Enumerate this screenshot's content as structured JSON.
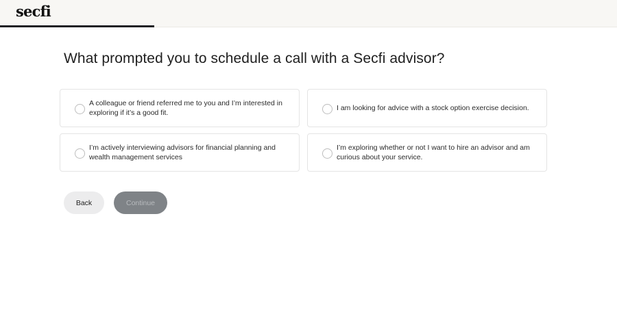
{
  "header": {
    "logo_text": "secfi"
  },
  "progress": {
    "fraction": 0.25
  },
  "question": {
    "title": "What prompted you to schedule a call with a Secfi advisor?"
  },
  "options": [
    {
      "label": "A colleague or friend referred me to you and I’m interested in exploring if it’s a good fit.",
      "selected": false
    },
    {
      "label": "I am looking for advice with a stock option exercise decision.",
      "selected": false
    },
    {
      "label": "I’m actively interviewing advisors for financial planning and wealth management services",
      "selected": false
    },
    {
      "label": "I’m exploring whether or not I want to hire an advisor and am curious about your service.",
      "selected": false
    }
  ],
  "buttons": {
    "back_label": "Back",
    "continue_label": "Continue",
    "continue_disabled": true
  },
  "colors": {
    "accent": "#1f1f24",
    "continue_bg": "#7f8387",
    "back_bg": "#ececed"
  }
}
